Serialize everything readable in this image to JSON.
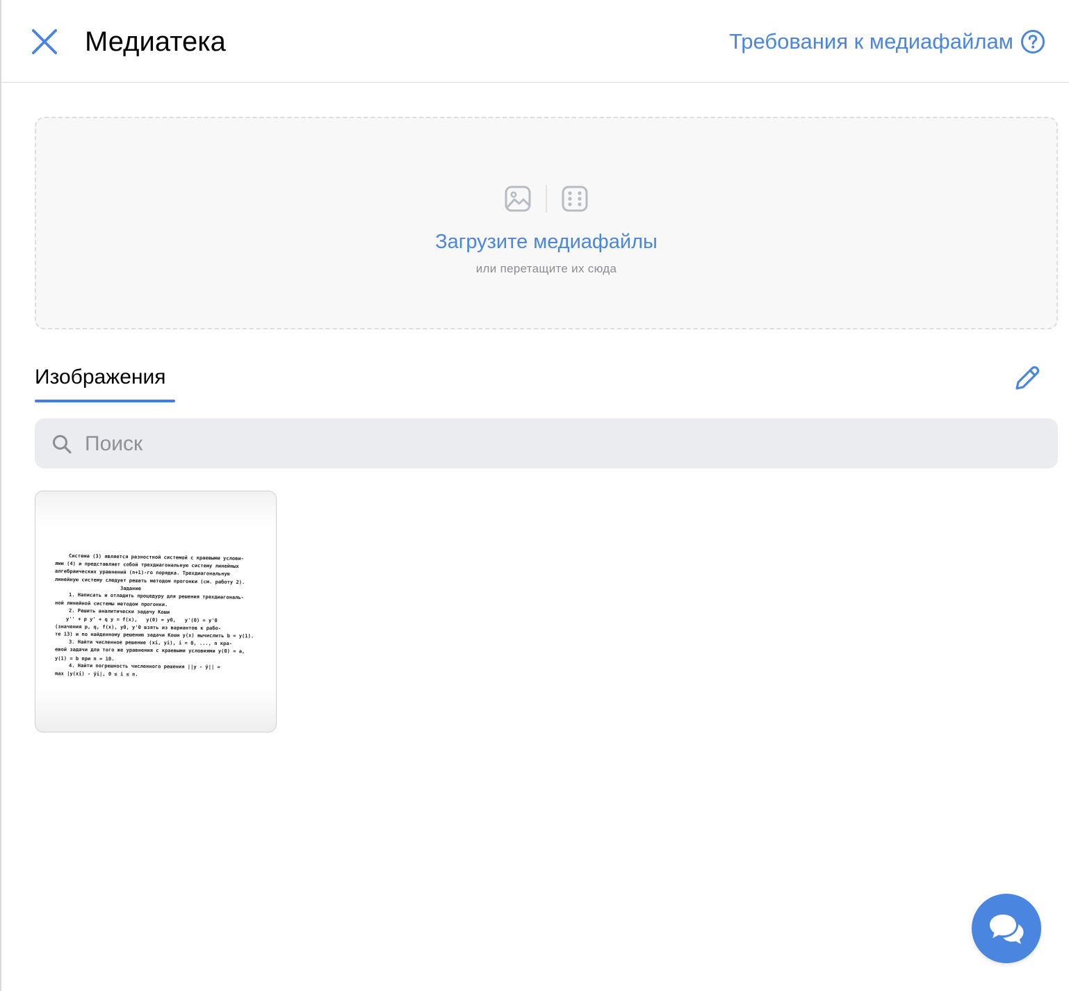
{
  "header": {
    "title": "Медиатека",
    "requirements_link": "Требования к медиафайлам"
  },
  "dropzone": {
    "main_text": "Загрузите медиафайлы",
    "sub_text": "или перетащите их сюда"
  },
  "tabs": [
    {
      "label": "Изображения",
      "active": true
    }
  ],
  "search": {
    "placeholder": "Поиск",
    "value": ""
  },
  "images": [
    {
      "lines": [
        "Система (3) является разностной системой с краевыми услови-",
        "ями (4) и представляет собой трехдиагональную систему линейных",
        "алгебраических уравнений (n+1)-го порядка. Трехдиагональную",
        "линейную систему следует решать методом прогонки (см. работу 2).",
        "Задание",
        "1. Написать и отладить процедуру для решения трехдиагональ-",
        "ной линейной системы методом прогонки.",
        "2. Решить аналитически задачу Коши",
        "y'' + p y' + q y = f(x),   y(0) = y0,   y'(0) = y'0",
        "(значения p, q, f(x), y0, y'0 взять из вариантов к рабо-",
        "те 13) и по найденному решению задачи Коши y(x) вычислить b = y(1).",
        "3. Найти численное решение (xi, yi), i = 0, ..., n кра-",
        "евой задачи для того же уравнения с краевыми условиями y(0) = a,",
        "y(1) = b при n = 10.",
        "4. Найти погрешность численного решения ||y - ỹ|| =",
        "max |y(xi) - ỹi|, 0 ≤ i ≤ n."
      ]
    }
  ],
  "colors": {
    "accent": "#4a86e0",
    "tab_underline": "#3f7fe0",
    "search_bg": "#ebecef",
    "dropzone_bg": "#f8f8f9"
  },
  "icons": [
    "close-icon",
    "help-circle-icon",
    "image-icon",
    "dice-icon",
    "pencil-icon",
    "search-icon",
    "chat-icon"
  ]
}
